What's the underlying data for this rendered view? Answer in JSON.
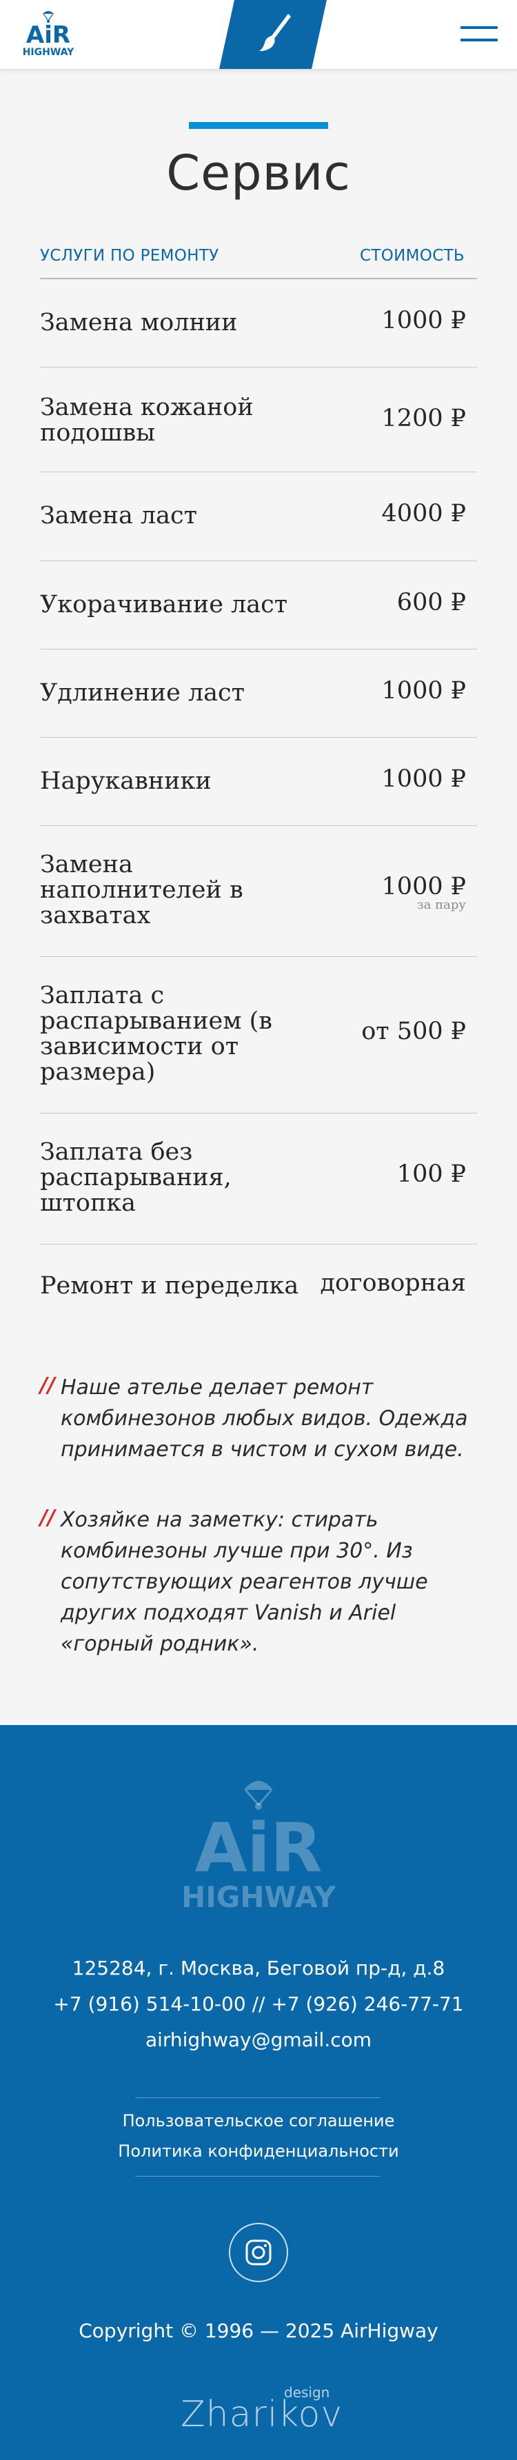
{
  "header": {
    "logo_text_top": "AiR",
    "logo_text_bottom": "HIGHWAY",
    "accent_color": "#0a67a8",
    "tab_icon": "paintbrush-icon",
    "menu_icon": "hamburger-menu-icon"
  },
  "page": {
    "title": "Сервис",
    "column_service": "УСЛУГИ ПО РЕМОНТУ",
    "column_price": "СТОИМОСТЬ"
  },
  "services": [
    {
      "name": "Замена молнии",
      "price": "1000 ₽",
      "note": ""
    },
    {
      "name": "Замена кожаной подошвы",
      "price": "1200 ₽",
      "note": ""
    },
    {
      "name": "Замена ласт",
      "price": "4000 ₽",
      "note": ""
    },
    {
      "name": "Укорачивание ласт",
      "price": "600 ₽",
      "note": ""
    },
    {
      "name": "Удлинение ласт",
      "price": "1000 ₽",
      "note": ""
    },
    {
      "name": "Нарукавники",
      "price": "1000 ₽",
      "note": ""
    },
    {
      "name": "Замена наполнителей в захватах",
      "price": "1000 ₽",
      "note": "за пару"
    },
    {
      "name": "Заплата с распарыванием (в зависимости от размера)",
      "price": "от 500 ₽",
      "note": ""
    },
    {
      "name": "Заплата без распарывания, штопка",
      "price": "100 ₽",
      "note": ""
    },
    {
      "name": "Ремонт и переделка",
      "price": "договорная",
      "note": ""
    }
  ],
  "notes": {
    "mark": "//",
    "items": [
      "Наше ателье делает ремонт комбинезонов любых видов. Одежда принимается в чистом и сухом виде.",
      "Хозяйке на заметку: стирать комбинезоны лучше при 30°. Из сопутствующих реагентов лучше других подходят Vanish и Ariel «горный родник»."
    ],
    "mark_color": "#d82a28"
  },
  "footer": {
    "logo_text_top": "AiR",
    "logo_text_bottom": "HIGHWAY",
    "address": "125284, г. Москва, Беговой пр-д, д.8",
    "phones": "+7 (916) 514-10-00 // +7 (926) 246-77-71",
    "email": "airhighway@gmail.com",
    "link_agreement": "Пользовательское соглашение",
    "link_privacy": "Политика конфиденциальности",
    "social_icon": "instagram-icon",
    "copyright": "Copyright © 1996 — 2025 AirHigway",
    "designer_name": "Zharikov",
    "designer_tag": "design",
    "background_color": "#0a67a8"
  }
}
